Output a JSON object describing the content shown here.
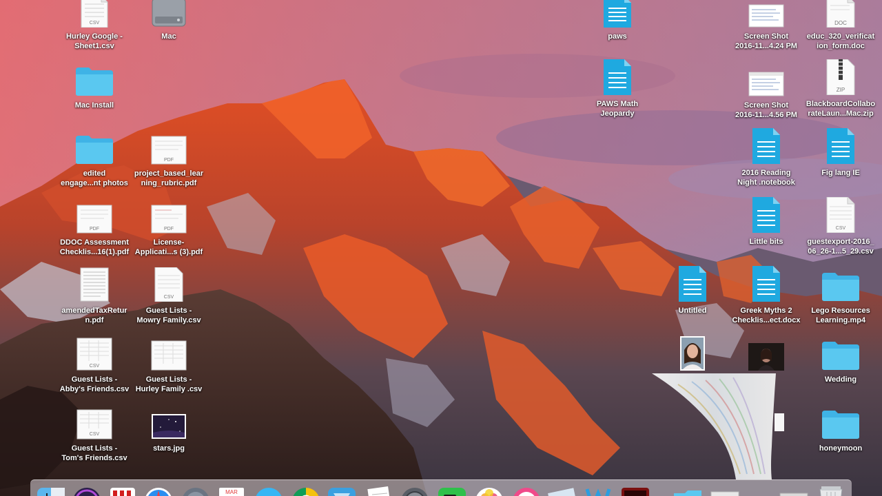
{
  "desktop": {
    "icons": [
      {
        "id": "hurley-google-sheet1",
        "type": "csv",
        "badge": "CSV",
        "label": "Hurley Google  -\nSheet1.csv"
      },
      {
        "id": "mac-drive",
        "type": "drive",
        "badge": "",
        "label": "Mac"
      },
      {
        "id": "mac-install",
        "type": "folder",
        "badge": "",
        "label": "Mac Install"
      },
      {
        "id": "edited-engagement-photos",
        "type": "folder",
        "badge": "",
        "label": "edited\nengage...nt photos"
      },
      {
        "id": "project-based-learning-rubric",
        "type": "pdf",
        "badge": "PDF",
        "label": "project_based_lear\nning_rubric.pdf"
      },
      {
        "id": "ddoc-assessment-checklist",
        "type": "pdf",
        "badge": "PDF",
        "label": "DDOC Assessment\nChecklis...16(1).pdf"
      },
      {
        "id": "license-application",
        "type": "pdf",
        "badge": "PDF",
        "label": "License-\nApplicati...s (3).pdf"
      },
      {
        "id": "amended-tax-return",
        "type": "doc-lines",
        "badge": "",
        "label": "amendedTaxRetur\nn.pdf"
      },
      {
        "id": "guest-lists-mowry",
        "type": "csv",
        "badge": "CSV",
        "label": "Guest Lists -\nMowry Family.csv"
      },
      {
        "id": "guest-lists-abby",
        "type": "csv",
        "badge": "CSV",
        "label": "Guest Lists -\nAbby's Friends.csv"
      },
      {
        "id": "guest-lists-hurley",
        "type": "csv",
        "badge": "",
        "label": "Guest Lists -\nHurley Family .csv"
      },
      {
        "id": "guest-lists-tom",
        "type": "csv",
        "badge": "CSV",
        "label": "Guest Lists -\nTom's Friends.csv"
      },
      {
        "id": "stars-jpg",
        "type": "image-stars",
        "badge": "",
        "label": "stars.jpg"
      },
      {
        "id": "paws",
        "type": "notebook",
        "badge": "",
        "label": "paws"
      },
      {
        "id": "paws-math-jeopardy",
        "type": "notebook",
        "badge": "",
        "label": "PAWS Math\nJeopardy"
      },
      {
        "id": "screen-shot-1",
        "type": "screenshot",
        "badge": "",
        "label": "Screen Shot\n2016-11...4.24 PM"
      },
      {
        "id": "educ-320-verification",
        "type": "doc",
        "badge": "DOC",
        "label": "educ_320_verificat\nion_form.doc"
      },
      {
        "id": "screen-shot-2",
        "type": "screenshot",
        "badge": "",
        "label": "Screen Shot\n2016-11...4.56 PM"
      },
      {
        "id": "blackboard-collaborate",
        "type": "zip",
        "badge": "ZIP",
        "label": "BlackboardCollabo\nrateLaun...Mac.zip"
      },
      {
        "id": "reading-night-notebook",
        "type": "notebook",
        "badge": "",
        "label": "2016 Reading\nNight .notebook"
      },
      {
        "id": "fig-lang-ie",
        "type": "notebook",
        "badge": "",
        "label": "Fig lang IE"
      },
      {
        "id": "little-bits",
        "type": "notebook",
        "badge": "",
        "label": "Little bits"
      },
      {
        "id": "guestexport",
        "type": "csv",
        "badge": "CSV",
        "label": "guestexport-2016_\n06_26-1...5_29.csv"
      },
      {
        "id": "untitled",
        "type": "notebook",
        "badge": "",
        "label": "Untitled"
      },
      {
        "id": "greek-myths-checklist",
        "type": "notebook",
        "badge": "",
        "label": "Greek Myths 2\nChecklis...ect.docx"
      },
      {
        "id": "lego-resources",
        "type": "folder",
        "badge": "",
        "label": "Lego Resources\nLearning.mp4"
      },
      {
        "id": "photo-woman-1",
        "type": "photo-portrait",
        "badge": "",
        "label": ""
      },
      {
        "id": "photo-woman-2",
        "type": "photo-dark",
        "badge": "",
        "label": ""
      },
      {
        "id": "wedding",
        "type": "folder",
        "badge": "",
        "label": "Wedding"
      },
      {
        "id": "honeymoon",
        "type": "folder",
        "badge": "",
        "label": "honeymoon"
      }
    ]
  },
  "dock": {
    "calendar_month": "MAR",
    "items": [
      "finder-icon",
      "siri-icon",
      "photo-booth-icon",
      "safari-icon",
      "launchpad-icon",
      "calendar-icon",
      "messages-icon",
      "chrome-icon",
      "xcode-icon",
      "textedit-icon",
      "system-preferences-icon",
      "facetime-icon",
      "photos-icon",
      "itunes-icon",
      "notes-icon",
      "smart-notebook-icon",
      "acrobat-icon",
      "downloads-folder-icon",
      "document-stack-icon",
      "documents-stack-icon",
      "trash-icon"
    ]
  },
  "colors": {
    "folder": "#5ac8f0",
    "notebook": "#1fa9e0",
    "label_text": "#ffffff"
  }
}
